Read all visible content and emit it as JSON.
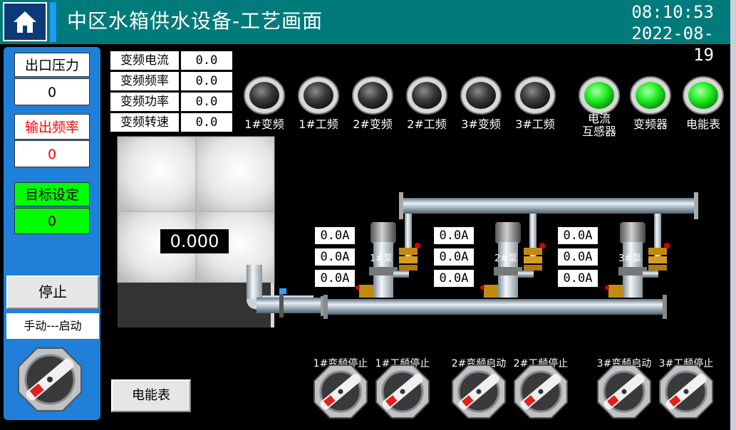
{
  "header": {
    "title": "中区水箱供水设备-工艺画面",
    "time": "08:10:53",
    "date": "2022-08-19"
  },
  "left_panel": {
    "outlet_pressure_label": "出口压力",
    "outlet_pressure_value": "0",
    "output_freq_label": "输出频率",
    "output_freq_value": "0",
    "target_label": "目标设定",
    "target_value": "0",
    "stop_label": "停止",
    "mode_text": "手动---启动"
  },
  "params": [
    {
      "label": "变频电流",
      "value": "0.0"
    },
    {
      "label": "变频频率",
      "value": "0.0"
    },
    {
      "label": "变频功率",
      "value": "0.0"
    },
    {
      "label": "变频转速",
      "value": "0.0"
    }
  ],
  "lamps": [
    {
      "label": "1#变频",
      "state": "off"
    },
    {
      "label": "1#工频",
      "state": "off"
    },
    {
      "label": "2#变频",
      "state": "off"
    },
    {
      "label": "2#工频",
      "state": "off"
    },
    {
      "label": "3#变频",
      "state": "off"
    },
    {
      "label": "3#工频",
      "state": "off"
    },
    {
      "label": "电流\n互感器",
      "state": "on"
    },
    {
      "label": "变频器",
      "state": "on"
    },
    {
      "label": "电能表",
      "state": "on"
    }
  ],
  "tank_level": "0.000",
  "pumps": [
    {
      "label": "1#泵",
      "currents": [
        "0.0A",
        "0.0A",
        "0.0A"
      ]
    },
    {
      "label": "2#泵",
      "currents": [
        "0.0A",
        "0.0A",
        "0.0A"
      ]
    },
    {
      "label": "3#泵",
      "currents": [
        "0.0A",
        "0.0A",
        "0.0A"
      ]
    }
  ],
  "switches": [
    {
      "label": "1#变频停止"
    },
    {
      "label": "1#工频停止"
    },
    {
      "label": "2#变频启动"
    },
    {
      "label": "2#工频停止"
    },
    {
      "label": "3#变频启动"
    },
    {
      "label": "3#工频停止"
    }
  ],
  "meter_button_label": "电能表",
  "colors": {
    "header": "#007a7a",
    "panel": "#1f7fd9",
    "lamp_on": "#33ff33",
    "lamp_off": "#444444",
    "target_bg": "#00ff00",
    "alert_text": "#ff0000"
  }
}
